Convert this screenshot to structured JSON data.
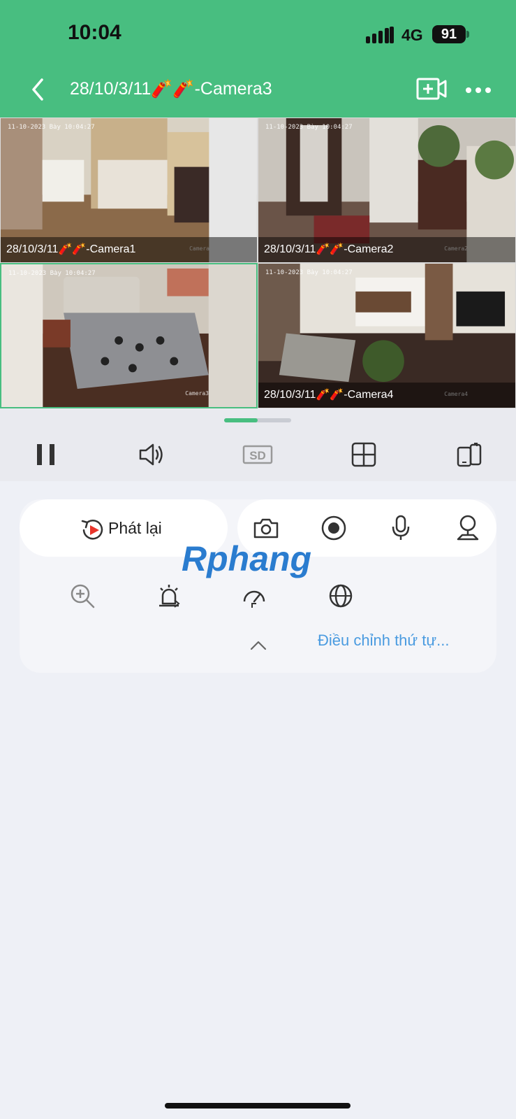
{
  "status_bar": {
    "time": "10:04",
    "network": "4G",
    "battery": "91"
  },
  "header": {
    "title": "28/10/3/11🧨🧨-Camera3"
  },
  "cameras": [
    {
      "label": "28/10/3/11🧨🧨-Camera1",
      "timestamp": "11-10-2023 Bày 10:04:27",
      "watermark": "Camera"
    },
    {
      "label": "28/10/3/11🧨🧨-Camera2",
      "timestamp": "11-10-2023 Bày 10:04:27",
      "watermark": "Camera2"
    },
    {
      "label": "",
      "timestamp": "11-10-2023 Bày 10:04:27",
      "watermark": "Camera3"
    },
    {
      "label": "28/10/3/11🧨🧨-Camera4",
      "timestamp": "11-10-2023 Bày 10:04:27",
      "watermark": "Camera4"
    }
  ],
  "controls": {
    "quality": "SD"
  },
  "panel": {
    "playback_label": "Phát lại",
    "reorder_label": "Điều chỉnh thứ tự..."
  },
  "watermark": {
    "text": "Rphang"
  },
  "colors": {
    "accent": "#48be80",
    "link": "#4a9be0"
  }
}
